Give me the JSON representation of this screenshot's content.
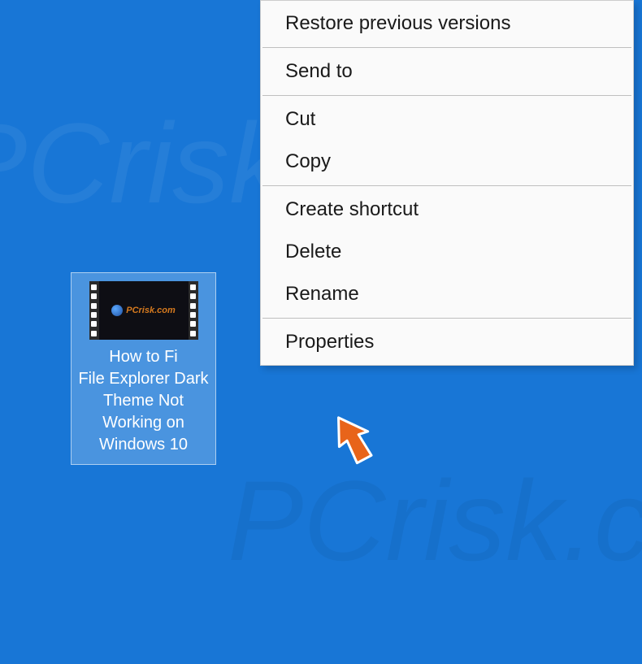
{
  "desktop": {
    "icon_label": "How to Fi\nFile Explorer Dark Theme Not Working on Windows 10",
    "thumb_text": "PCrisk.com"
  },
  "context_menu": {
    "items": [
      {
        "label": "Restore previous versions",
        "sep_after": true
      },
      {
        "label": "Send to",
        "sep_after": true
      },
      {
        "label": "Cut",
        "sep_after": false
      },
      {
        "label": "Copy",
        "sep_after": true
      },
      {
        "label": "Create shortcut",
        "sep_after": false
      },
      {
        "label": "Delete",
        "sep_after": false
      },
      {
        "label": "Rename",
        "sep_after": true
      },
      {
        "label": "Properties",
        "sep_after": false
      }
    ]
  },
  "watermark": "PCrisk.com"
}
